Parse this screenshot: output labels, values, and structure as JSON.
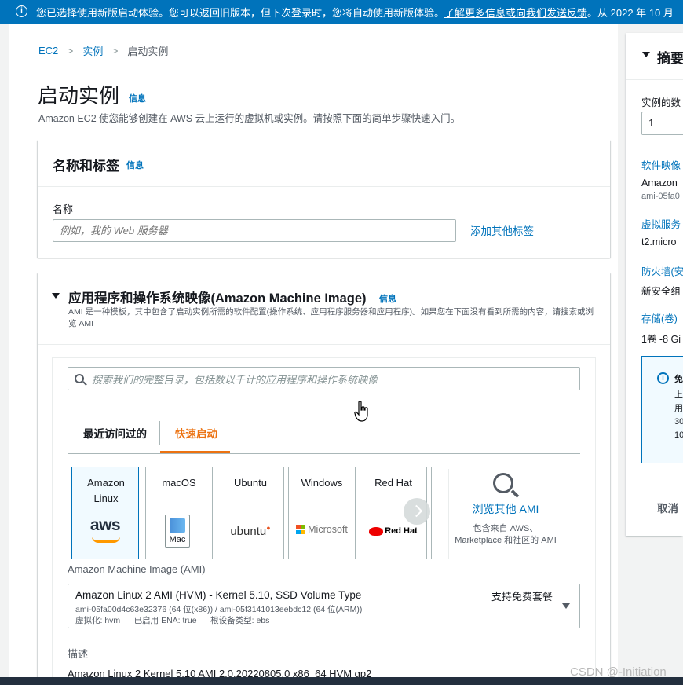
{
  "banner": {
    "icon": "info-icon",
    "text": "您已选择使用新版启动体验。您可以返回旧版本，但下次登录时，您将自动使用新版体验。",
    "link": "了解更多信息或向我们发送反馈",
    "tail": "。从 2022 年 10 月"
  },
  "breadcrumb": {
    "root": "EC2",
    "mid": "实例",
    "current": "启动实例"
  },
  "page": {
    "title": "启动实例",
    "info": "信息",
    "description": "Amazon EC2 使您能够创建在 AWS 云上运行的虚拟机或实例。请按照下面的简单步骤快速入门。"
  },
  "name_section": {
    "title": "名称和标签",
    "info": "信息",
    "name_label": "名称",
    "name_placeholder": "例如，我的 Web 服务器",
    "add_tags": "添加其他标签"
  },
  "ami_section": {
    "title": "应用程序和操作系统映像(Amazon Machine Image)",
    "info": "信息",
    "description": "AMI 是一种模板，其中包含了启动实例所需的软件配置(操作系统、应用程序服务器和应用程序)。如果您在下面没有看到所需的内容，请搜索或浏览 AMI",
    "search_placeholder": "搜索我们的完整目录，包括数以千计的应用程序和操作系统映像",
    "tabs": [
      "最近访问过的",
      "快速启动"
    ],
    "tiles": [
      {
        "label": "Amazon Linux",
        "logo": "aws"
      },
      {
        "label": "macOS",
        "logo": "Mac"
      },
      {
        "label": "Ubuntu",
        "logo": "ubuntu"
      },
      {
        "label": "Windows",
        "logo": "Microsoft"
      },
      {
        "label": "Red Hat",
        "logo": "Red Hat"
      },
      {
        "label": "S",
        "logo": ""
      }
    ],
    "browse_label": "浏览其他 AMI",
    "browse_desc": "包含来自 AWS、Marketplace 和社区的 AMI",
    "ami_label": "Amazon Machine Image (AMI)",
    "ami_name": "Amazon Linux 2 AMI (HVM) - Kernel 5.10, SSD Volume Type",
    "ami_free": "支持免费套餐",
    "ami_ids": "ami-05fa00d4c63e32376 (64 位(x86)) / ami-05f3141013eebdc12 (64 位(ARM))",
    "ami_meta": "虚拟化: hvm      已启用 ENA: true      根设备类型: ebs",
    "desc_label": "描述",
    "desc_value": "Amazon Linux 2 Kernel 5.10 AMI 2.0.20220805.0 x86_64 HVM gp2"
  },
  "summary": {
    "title": "摘要",
    "instances_label": "实例的数",
    "instances_value": "1",
    "software_label": "软件映像",
    "software_value": "Amazon",
    "software_sub": "ami-05fa0",
    "server_label": "虚拟服务",
    "server_value": "t2.micro",
    "firewall_label": "防火墙(安",
    "firewall_value": "新安全组",
    "storage_label": "存储(卷)",
    "storage_value": "1卷 -8 Gi",
    "alert_title": "免",
    "alert_lines": "上\n用\n30\n10",
    "cancel": "取消"
  },
  "watermark": "CSDN @-Initiation",
  "colors": {
    "accent": "#0073bb",
    "orange": "#ec7211",
    "banner": "#0073bb"
  }
}
